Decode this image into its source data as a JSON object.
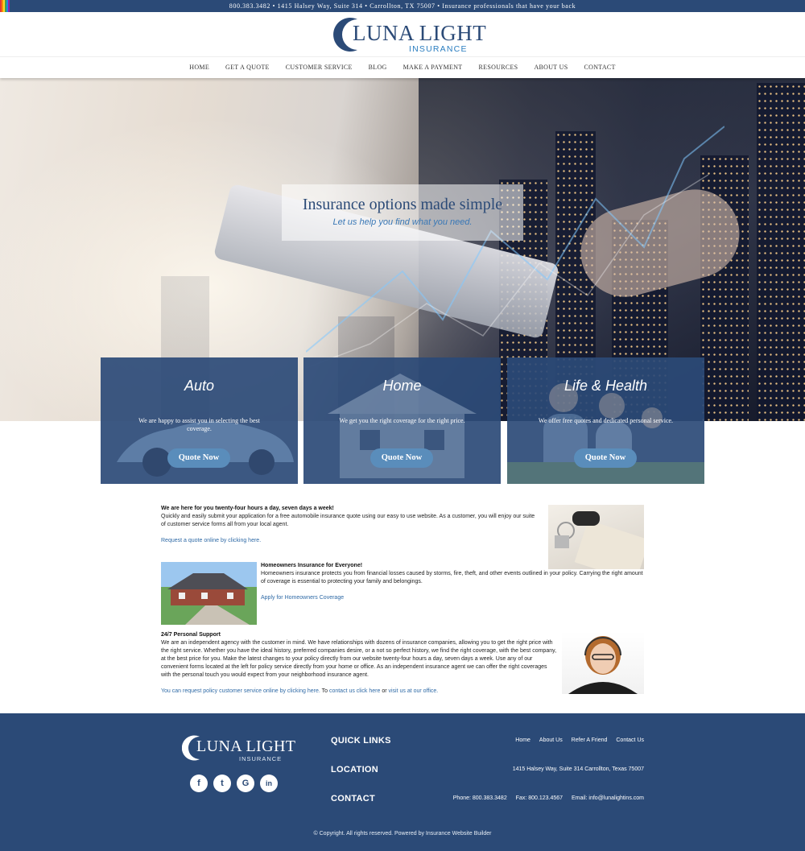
{
  "topbar": {
    "text": "800.383.3482 • 1415 Halsey Way, Suite 314 • Carrollton, TX 75007 • Insurance professionals that have your back"
  },
  "logo": {
    "name": "LUNA LIGHT",
    "sub": "INSURANCE"
  },
  "nav": {
    "items": [
      "HOME",
      "GET A QUOTE",
      "CUSTOMER SERVICE",
      "BLOG",
      "MAKE A PAYMENT",
      "RESOURCES",
      "ABOUT US",
      "CONTACT"
    ]
  },
  "hero": {
    "title": "Insurance options made simple",
    "subtitle": "Let us help you find what you need."
  },
  "cards": [
    {
      "title": "Auto",
      "desc": "We are happy to assist you in selecting the best coverage.",
      "button": "Quote Now"
    },
    {
      "title": "Home",
      "desc": "We get you the right coverage for the right price.",
      "button": "Quote Now"
    },
    {
      "title": "Life & Health",
      "desc": "We offer free quotes and dedicated personal service.",
      "button": "Quote Now"
    }
  ],
  "sections": {
    "auto": {
      "head": "We are here for you twenty-four hours a day, seven days a week!",
      "body": "Quickly and easily submit your application for a free automobile insurance quote using our easy to use website. As a customer, you will enjoy our suite of customer service forms all from your local agent.",
      "link": "Request a quote online by clicking here."
    },
    "home": {
      "head": "Homeowners Insurance for Everyone!",
      "body": "Homeowners insurance protects you from financial losses caused by storms, fire, theft, and other events outlined in your policy. Carrying the right amount of coverage is essential to protecting your family and belongings.",
      "link": "Apply for Homeowners Coverage"
    },
    "support": {
      "head": "24/7 Personal Support",
      "body": "We are an independent agency with the customer in mind. We have relationships with dozens of insurance companies, allowing you to get the right price with the right service. Whether you have the ideal history, preferred companies desire, or a not so perfect history, we find the right coverage, with the best company, at the best price for you. Make the latest changes to your policy directly from our website twenty-four hours a day, seven days a week. Use any of our convenient forms located at the left for policy service directly from your home or office.  As an independent insurance agent we can offer the right coverages with the personal touch you would expect from your neighborhood insurance agent.",
      "link1": "You can request policy customer service online by clicking here.",
      "mid": " To ",
      "link2": "contact us click here",
      "or": " or ",
      "link3": "visit us at our office."
    }
  },
  "footer": {
    "logo_name": "LUNA LIGHT",
    "logo_sub": "INSURANCE",
    "social": [
      "f",
      "t",
      "G",
      "in"
    ],
    "quick_links_head": "QUICK LINKS",
    "quick_links": [
      "Home",
      "About Us",
      "Refer A Friend",
      "Contact Us"
    ],
    "location_head": "LOCATION",
    "location": "1415 Halsey Way, Suite 314 Carrollton, Texas 75007",
    "contact_head": "CONTACT",
    "phone": "Phone: 800.383.3482",
    "fax": "Fax: 800.123.4567",
    "email": "Email: info@lunalightins.com",
    "copyright": "© Copyright. All rights reserved. Powered by Insurance Website Builder"
  }
}
